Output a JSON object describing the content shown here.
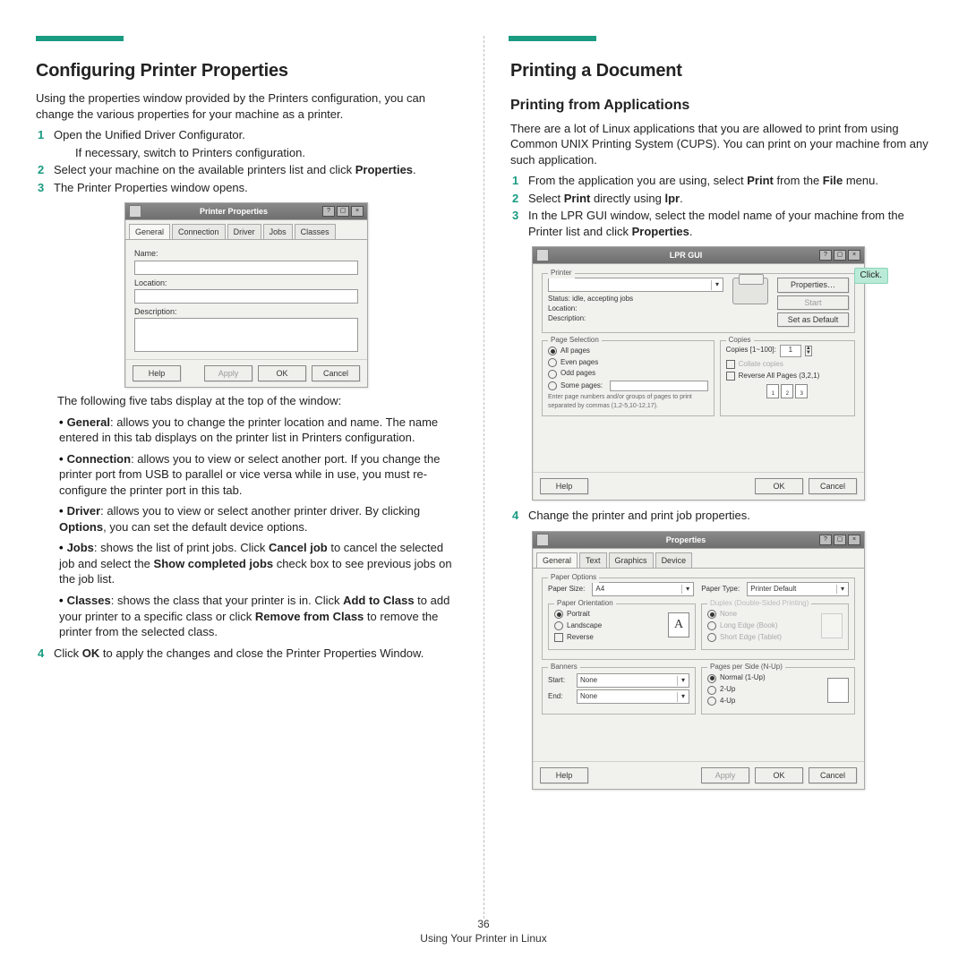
{
  "left": {
    "heading": "Configuring Printer Properties",
    "intro": "Using the properties window provided by the Printers configuration, you can change the various properties for your machine as a printer.",
    "steps": {
      "s1": {
        "num": "1",
        "text": "Open the Unified Driver Configurator.",
        "sub": "If necessary, switch to Printers configuration."
      },
      "s2": {
        "num": "2",
        "text": "Select your machine on the available printers list and click ",
        "bold": "Properties",
        "tail": "."
      },
      "s3": {
        "num": "3",
        "text": "The Printer Properties window opens."
      },
      "s4": {
        "num": "4",
        "text_a": "Click ",
        "bold": "OK",
        "text_b": " to apply the changes and close the Printer Properties Window."
      }
    },
    "props_panel": {
      "title": "Printer Properties",
      "tabs": {
        "t1": "General",
        "t2": "Connection",
        "t3": "Driver",
        "t4": "Jobs",
        "t5": "Classes"
      },
      "labels": {
        "name": "Name:",
        "location": "Location:",
        "description": "Description:"
      },
      "btn_help": "Help",
      "btn_apply": "Apply",
      "btn_ok": "OK",
      "btn_cancel": "Cancel"
    },
    "tabs_intro": "The following five tabs display at the top of the window:",
    "tabs_desc": {
      "general_b": "General",
      "general": ": allows you to change the printer location and name. The name entered in this tab displays on the printer list in Printers configuration.",
      "connection_b": "Connection",
      "connection": ": allows you to view or select another port. If you change the printer port from USB to parallel or vice versa while in use, you must re-configure the printer port in this tab.",
      "driver_b": "Driver",
      "driver_a": ": allows you to view or select another printer driver. By clicking ",
      "driver_opt": "Options",
      "driver_c": ", you can set the default device options.",
      "jobs_b": "Jobs",
      "jobs_a": ": shows the list of print jobs. Click ",
      "jobs_cancel": "Cancel job",
      "jobs_b2": " to cancel the selected job and select the ",
      "jobs_show": "Show completed jobs",
      "jobs_c": " check box to see previous jobs on the job list.",
      "classes_b": "Classes",
      "classes_a": ": shows the class that your printer is in. Click ",
      "classes_add": "Add to Class",
      "classes_b2": " to add your printer to a specific class or click ",
      "classes_rem": "Remove from Class",
      "classes_c": " to remove the printer from the selected class."
    }
  },
  "right": {
    "heading": "Printing a Document",
    "subheading": "Printing from Applications",
    "intro": "There are a lot of Linux applications that you are allowed to print from using Common UNIX Printing System (CUPS). You can print on your machine from any such application.",
    "steps": {
      "s1": {
        "num": "1",
        "a": "From the application you are using, select ",
        "b": "Print",
        "c": " from the ",
        "d": "File",
        "e": " menu."
      },
      "s2": {
        "num": "2",
        "a": "Select ",
        "b": "Print",
        "c": " directly using ",
        "d": "lpr",
        "e": "."
      },
      "s3": {
        "num": "3",
        "a": "In the LPR GUI window, select the model name of your machine from the Printer list and click ",
        "b": "Properties",
        "c": "."
      },
      "s4": {
        "num": "4",
        "a": "Change the printer and print job properties."
      }
    },
    "callout_click": "Click.",
    "lpr_panel": {
      "title": "LPR GUI",
      "printer_group": "Printer",
      "status": "Status: idle, accepting jobs",
      "location": "Location:",
      "description": "Description:",
      "btn_props": "Properties…",
      "btn_start": "Start",
      "btn_default": "Set as Default",
      "page_sel_group": "Page Selection",
      "ps_all": "All pages",
      "ps_even": "Even pages",
      "ps_odd": "Odd pages",
      "ps_some": "Some pages:",
      "ps_hint": "Enter page numbers and/or groups of pages to print separated by commas (1,2-5,10-12,17).",
      "copies_group": "Copies",
      "copies_lbl": "Copies [1~100]:",
      "copies_val": "1",
      "collate": "Collate copies",
      "reverse": "Reverse All Pages (3,2,1)",
      "btn_help": "Help",
      "btn_ok": "OK",
      "btn_cancel": "Cancel"
    },
    "props_panel": {
      "title": "Properties",
      "tabs": {
        "t1": "General",
        "t2": "Text",
        "t3": "Graphics",
        "t4": "Device"
      },
      "paper_opts": "Paper Options",
      "paper_size": "Paper Size:",
      "paper_size_val": "A4",
      "paper_type": "Paper Type:",
      "paper_type_val": "Printer Default",
      "orientation": "Paper Orientation",
      "portrait": "Portrait",
      "landscape": "Landscape",
      "reverse": "Reverse",
      "a_icon": "A",
      "duplex": "Duplex (Double-Sided Printing)",
      "dup_none": "None",
      "dup_long": "Long Edge (Book)",
      "dup_short": "Short Edge (Tablet)",
      "banners": "Banners",
      "start": "Start:",
      "end": "End:",
      "none_val": "None",
      "pps": "Pages per Side (N-Up)",
      "nup1": "Normal (1-Up)",
      "nup2": "2-Up",
      "nup4": "4-Up",
      "btn_help": "Help",
      "btn_apply": "Apply",
      "btn_ok": "OK",
      "btn_cancel": "Cancel"
    }
  },
  "footer": {
    "page_num": "36",
    "chapter": "Using Your Printer in Linux"
  }
}
